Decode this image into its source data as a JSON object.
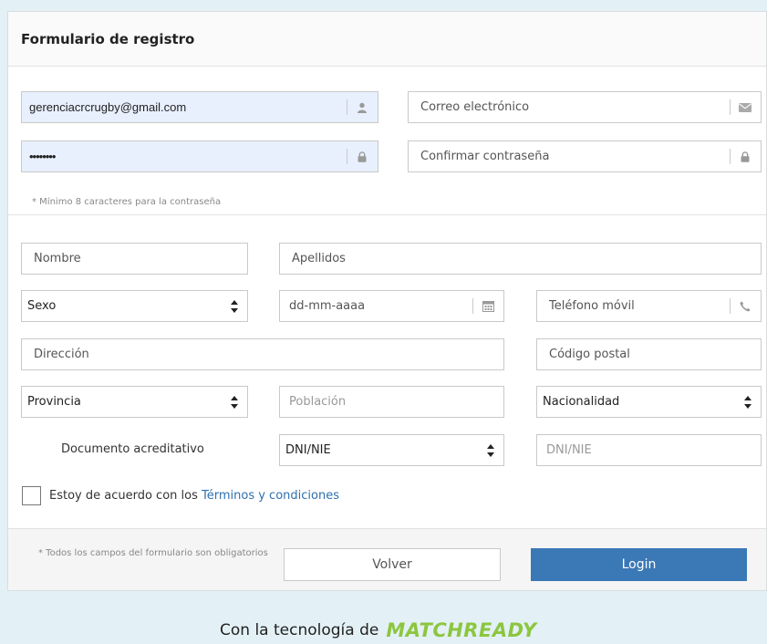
{
  "form": {
    "title": "Formulario de registro",
    "username_value": "gerenciacrcrugby@gmail.com",
    "password_value": "••••••••",
    "email_placeholder": "Correo electrónico",
    "confirm_password_placeholder": "Confirmar contraseña",
    "password_hint": "* Mínimo 8 caracteres para la contraseña",
    "nombre_placeholder": "Nombre",
    "apellidos_placeholder": "Apellidos",
    "sexo_selected": "Sexo",
    "fecha_placeholder": "dd-mm-aaaa",
    "telefono_placeholder": "Teléfono móvil",
    "direccion_placeholder": "Dirección",
    "codigo_postal_placeholder": "Código postal",
    "provincia_selected": "Provincia",
    "poblacion_placeholder": "Población",
    "nacionalidad_selected": "Nacionalidad",
    "documento_label": "Documento acreditativo",
    "documento_type_selected": "DNI/NIE",
    "documento_number_placeholder": "DNI/NIE",
    "terms_text": "Estoy de acuerdo con los",
    "terms_link": "Términos y condiciones"
  },
  "footer": {
    "required_note": "* Todos los campos del formulario son obligatorios",
    "back_label": "Volver",
    "login_label": "Login"
  },
  "powered_by": {
    "text": "Con la tecnología de",
    "brand": "MATCHREADY"
  },
  "icons": {
    "user": "user-icon",
    "envelope": "envelope-icon",
    "lock": "lock-icon",
    "calendar": "calendar-icon",
    "phone": "phone-icon",
    "select_arrows": "select-arrows-icon"
  },
  "colors": {
    "page_background": "#e3f1f6",
    "autofill_background": "#e8f0fe",
    "login_button": "#3a78b6",
    "link": "#2f6fae",
    "brand": "#8cc63f"
  }
}
